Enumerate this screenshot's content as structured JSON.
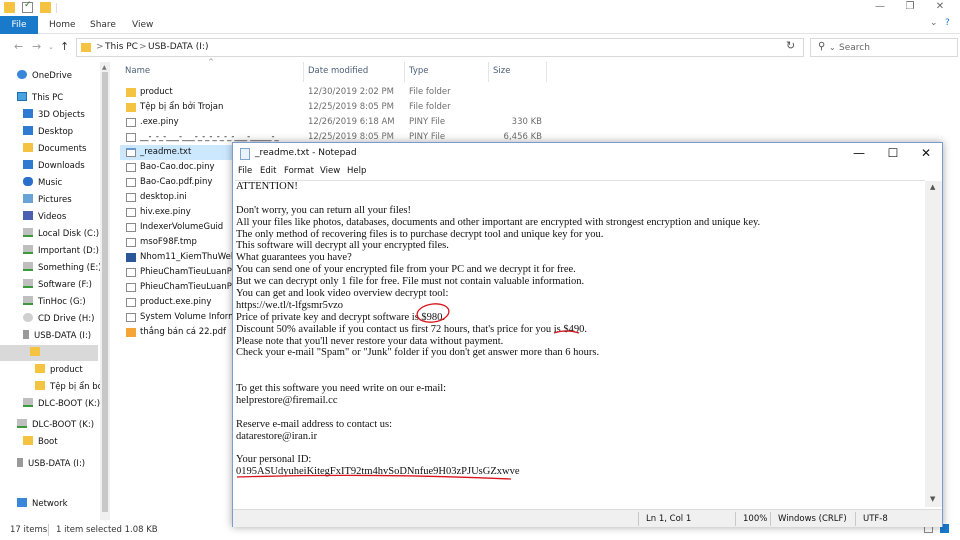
{
  "ribbon": {
    "file": "File",
    "home": "Home",
    "share": "Share",
    "view": "View"
  },
  "address": {
    "crumbs": [
      "This PC",
      "USB-DATA (I:)"
    ],
    "sep": ">"
  },
  "search": {
    "placeholder": "Search"
  },
  "nav": {
    "items": [
      {
        "label": "OneDrive",
        "icon": "cloud"
      },
      {
        "label": "This PC",
        "icon": "pc"
      },
      {
        "label": "3D Objects",
        "icon": "blue"
      },
      {
        "label": "Desktop",
        "icon": "blue"
      },
      {
        "label": "Documents",
        "icon": "folder"
      },
      {
        "label": "Downloads",
        "icon": "down"
      },
      {
        "label": "Music",
        "icon": "music"
      },
      {
        "label": "Pictures",
        "icon": "pic"
      },
      {
        "label": "Videos",
        "icon": "vid"
      },
      {
        "label": "Local Disk (C:)",
        "icon": "drive"
      },
      {
        "label": "Important (D:)",
        "icon": "drive"
      },
      {
        "label": "Something (E:)",
        "icon": "drive"
      },
      {
        "label": "Software (F:)",
        "icon": "drive"
      },
      {
        "label": "TinHoc (G:)",
        "icon": "drive"
      },
      {
        "label": "CD Drive (H:)",
        "icon": "dvd"
      },
      {
        "label": "USB-DATA (I:)",
        "icon": "usb"
      },
      {
        "label": "",
        "icon": "folder"
      },
      {
        "label": "product",
        "icon": "folder"
      },
      {
        "label": "Tệp bị ẩn bởi",
        "icon": "folder"
      },
      {
        "label": "DLC-BOOT (K:)",
        "icon": "drive"
      },
      {
        "label": "DLC-BOOT (K:)",
        "icon": "drive"
      },
      {
        "label": "Boot",
        "icon": "folder"
      },
      {
        "label": "USB-DATA (I:)",
        "icon": "usb"
      },
      {
        "label": "Network",
        "icon": "net"
      }
    ]
  },
  "columns": {
    "name": "Name",
    "date": "Date modified",
    "type": "Type",
    "size": "Size"
  },
  "files": [
    {
      "name": "product",
      "date": "12/30/2019 2:02 PM",
      "type": "File folder",
      "size": "",
      "icon": "folder"
    },
    {
      "name": "Tệp bị ẩn bởi Trojan",
      "date": "12/25/2019 8:05 PM",
      "type": "File folder",
      "size": "",
      "icon": "folder"
    },
    {
      "name": ".exe.piny",
      "date": "12/26/2019 6:18 AM",
      "type": "PINY File",
      "size": "330 KB",
      "icon": "doc"
    },
    {
      "name": "__-_-_-___-___-_-_-_-_-_-___-_____-_",
      "date": "12/25/2019 8:05 PM",
      "type": "PINY File",
      "size": "6,456 KB",
      "icon": "doc"
    },
    {
      "name": "_readme.txt",
      "date": "",
      "type": "",
      "size": "",
      "icon": "txt"
    },
    {
      "name": "Bao-Cao.doc.piny",
      "date": "",
      "type": "",
      "size": "",
      "icon": "doc"
    },
    {
      "name": "Bao-Cao.pdf.piny",
      "date": "",
      "type": "",
      "size": "",
      "icon": "doc"
    },
    {
      "name": "desktop.ini",
      "date": "",
      "type": "",
      "size": "",
      "icon": "doc"
    },
    {
      "name": "hiv.exe.piny",
      "date": "",
      "type": "",
      "size": "",
      "icon": "doc"
    },
    {
      "name": "IndexerVolumeGuid",
      "date": "",
      "type": "",
      "size": "",
      "icon": "doc"
    },
    {
      "name": "msoF98F.tmp",
      "date": "",
      "type": "",
      "size": "",
      "icon": "doc"
    },
    {
      "name": "Nhom11_KiemThuWebsit",
      "date": "",
      "type": "",
      "size": "",
      "icon": "word"
    },
    {
      "name": "PhieuChamTieuLuanPhat",
      "date": "",
      "type": "",
      "size": "",
      "icon": "doc"
    },
    {
      "name": "PhieuChamTieuLuanPhat",
      "date": "",
      "type": "",
      "size": "",
      "icon": "doc"
    },
    {
      "name": "product.exe.piny",
      "date": "",
      "type": "",
      "size": "",
      "icon": "doc"
    },
    {
      "name": "System Volume Informati",
      "date": "",
      "type": "",
      "size": "",
      "icon": "doc"
    },
    {
      "name": "thắng bán cá 22.pdf",
      "date": "",
      "type": "",
      "size": "",
      "icon": "pdf"
    }
  ],
  "status": {
    "count": "17 items",
    "selected": "1 item selected  1.08 KB"
  },
  "notepad": {
    "title": "_readme.txt - Notepad",
    "menu": [
      "File",
      "Edit",
      "Format",
      "View",
      "Help"
    ],
    "lines": [
      "ATTENTION!",
      "",
      "Don't worry, you can return all your files!",
      "All your files like photos, databases, documents and other important are encrypted with strongest encryption and unique key.",
      "The only method of recovering files is to purchase decrypt tool and unique key for you.",
      "This software will decrypt all your encrypted files.",
      "What guarantees you have?",
      "You can send one of your encrypted file from your PC and we decrypt it for free.",
      "But we can decrypt only 1 file for free. File must not contain valuable information.",
      "You can get and look video overview decrypt tool:",
      "https://we.tl/t-lfgsmr5vzo",
      "Price of private key and decrypt software is $980.",
      "Discount 50% available if you contact us first 72 hours, that's price for you is $490.",
      "Please note that you'll never restore your data without payment.",
      "Check your e-mail \"Spam\" or \"Junk\" folder if you don't get answer more than 6 hours.",
      "",
      "",
      "To get this software you need write on our e-mail:",
      "helprestore@firemail.cc",
      "",
      "Reserve e-mail address to contact us:",
      "datarestore@iran.ir",
      "",
      "Your personal ID:",
      "0195ASUdyuheiKitegFxIT92tm4hvSoDNnfue9H03zPJUsGZxwve"
    ],
    "status": {
      "pos": "Ln 1, Col 1",
      "zoom": "100%",
      "eol": "Windows (CRLF)",
      "enc": "UTF-8"
    },
    "mark_color": "#d8141c"
  }
}
